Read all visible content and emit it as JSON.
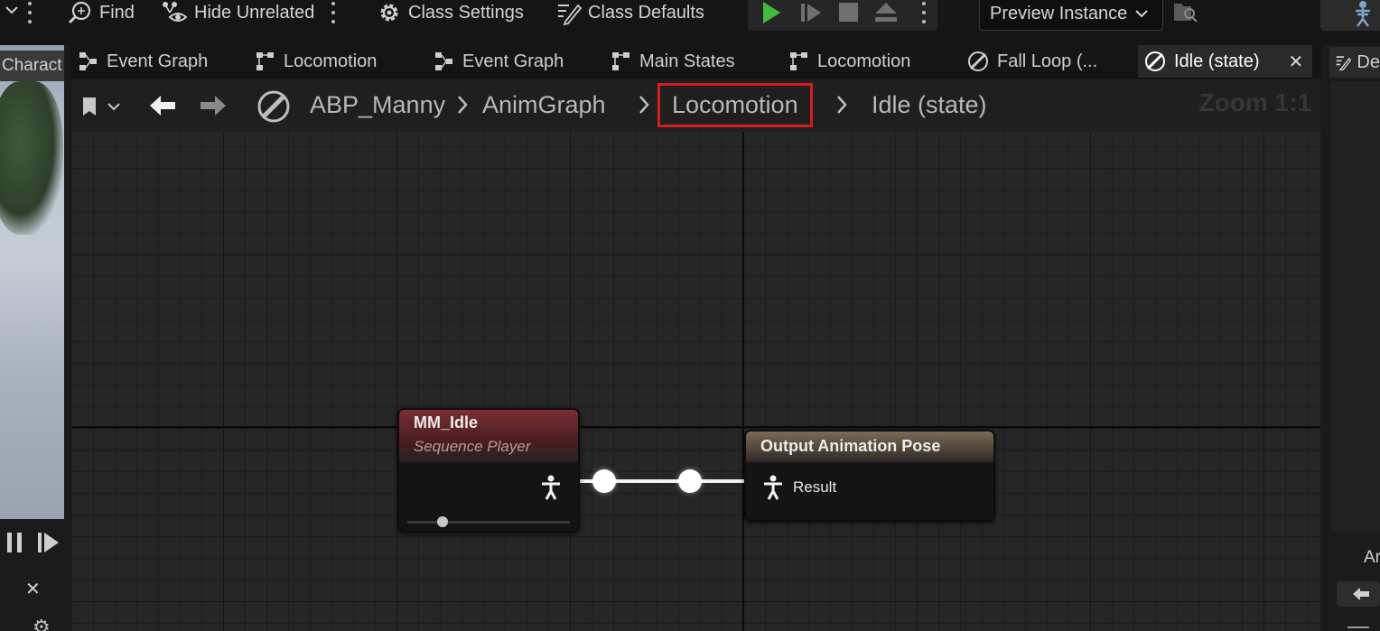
{
  "toolbar": {
    "find_label": "Find",
    "hide_unrelated_label": "Hide Unrelated",
    "class_settings_label": "Class Settings",
    "class_defaults_label": "Class Defaults",
    "preview_instance_label": "Preview Instance",
    "play_color": "#3fbd3f"
  },
  "left_panel": {
    "tab_label": "Charact"
  },
  "tabs": [
    {
      "label": "Event Graph",
      "icon": "event-graph-icon"
    },
    {
      "label": "Locomotion",
      "icon": "state-machine-icon"
    },
    {
      "label": "Event Graph",
      "icon": "event-graph-icon"
    },
    {
      "label": "Main States",
      "icon": "state-machine-icon"
    },
    {
      "label": "Locomotion",
      "icon": "state-machine-icon"
    },
    {
      "label": "Fall Loop (...",
      "icon": "state-icon"
    },
    {
      "label": "Idle (state)",
      "icon": "state-icon",
      "active": true
    }
  ],
  "right_panel": {
    "tab_label": "De",
    "section_label": "Ar"
  },
  "breadcrumb": {
    "items": [
      "ABP_Manny",
      "AnimGraph",
      "Locomotion",
      "Idle (state)"
    ],
    "highlighted": "Locomotion",
    "highlight_color": "#d61b1b",
    "zoom_label": "Zoom 1:1"
  },
  "graph": {
    "sequence_node": {
      "title": "MM_Idle",
      "subtitle": "Sequence Player",
      "header_color": "#6e2a2e"
    },
    "output_node": {
      "title": "Output Animation Pose",
      "pin_label": "Result",
      "header_color": "#6a5b4a"
    }
  }
}
